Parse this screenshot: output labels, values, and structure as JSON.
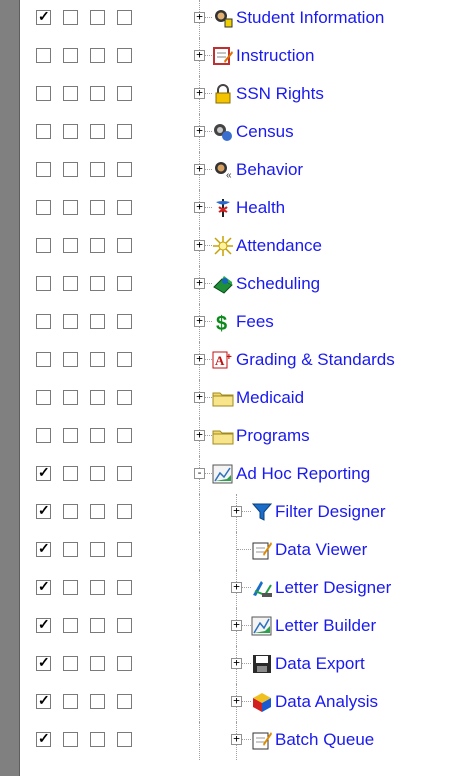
{
  "tree": {
    "items": [
      {
        "label": "Student Information",
        "checked": [
          true,
          false,
          false,
          false
        ],
        "icon": "student-icon",
        "level": 0,
        "expander": "+"
      },
      {
        "label": "Instruction",
        "checked": [
          false,
          false,
          false,
          false
        ],
        "icon": "instruction-icon",
        "level": 0,
        "expander": "+"
      },
      {
        "label": "SSN Rights",
        "checked": [
          false,
          false,
          false,
          false
        ],
        "icon": "lock-icon",
        "level": 0,
        "expander": "+"
      },
      {
        "label": "Census",
        "checked": [
          false,
          false,
          false,
          false
        ],
        "icon": "census-icon",
        "level": 0,
        "expander": "+"
      },
      {
        "label": "Behavior",
        "checked": [
          false,
          false,
          false,
          false
        ],
        "icon": "behavior-icon",
        "level": 0,
        "expander": "+"
      },
      {
        "label": "Health",
        "checked": [
          false,
          false,
          false,
          false
        ],
        "icon": "health-icon",
        "level": 0,
        "expander": "+"
      },
      {
        "label": "Attendance",
        "checked": [
          false,
          false,
          false,
          false
        ],
        "icon": "attendance-icon",
        "level": 0,
        "expander": "+"
      },
      {
        "label": "Scheduling",
        "checked": [
          false,
          false,
          false,
          false
        ],
        "icon": "scheduling-icon",
        "level": 0,
        "expander": "+"
      },
      {
        "label": "Fees",
        "checked": [
          false,
          false,
          false,
          false
        ],
        "icon": "dollar-icon",
        "level": 0,
        "expander": "+"
      },
      {
        "label": "Grading & Standards",
        "checked": [
          false,
          false,
          false,
          false
        ],
        "icon": "grade-icon",
        "level": 0,
        "expander": "+"
      },
      {
        "label": "Medicaid",
        "checked": [
          false,
          false,
          false,
          false
        ],
        "icon": "folder-icon",
        "level": 0,
        "expander": "+"
      },
      {
        "label": "Programs",
        "checked": [
          false,
          false,
          false,
          false
        ],
        "icon": "folder-icon",
        "level": 0,
        "expander": "+"
      },
      {
        "label": "Ad Hoc Reporting",
        "checked": [
          true,
          false,
          false,
          false
        ],
        "icon": "report-icon",
        "level": 0,
        "expander": "-"
      },
      {
        "label": "Filter Designer",
        "checked": [
          true,
          false,
          false,
          false
        ],
        "icon": "filter-icon",
        "level": 1,
        "expander": "+"
      },
      {
        "label": "Data Viewer",
        "checked": [
          true,
          false,
          false,
          false
        ],
        "icon": "data-viewer-icon",
        "level": 1,
        "expander": ""
      },
      {
        "label": "Letter Designer",
        "checked": [
          true,
          false,
          false,
          false
        ],
        "icon": "letter-designer-icon",
        "level": 1,
        "expander": "+"
      },
      {
        "label": "Letter Builder",
        "checked": [
          true,
          false,
          false,
          false
        ],
        "icon": "letter-builder-icon",
        "level": 1,
        "expander": "+"
      },
      {
        "label": "Data Export",
        "checked": [
          true,
          false,
          false,
          false
        ],
        "icon": "save-icon",
        "level": 1,
        "expander": "+"
      },
      {
        "label": "Data Analysis",
        "checked": [
          true,
          false,
          false,
          false
        ],
        "icon": "cube-icon",
        "level": 1,
        "expander": "+"
      },
      {
        "label": "Batch Queue",
        "checked": [
          true,
          false,
          false,
          false
        ],
        "icon": "batch-icon",
        "level": 1,
        "expander": "+"
      }
    ]
  }
}
